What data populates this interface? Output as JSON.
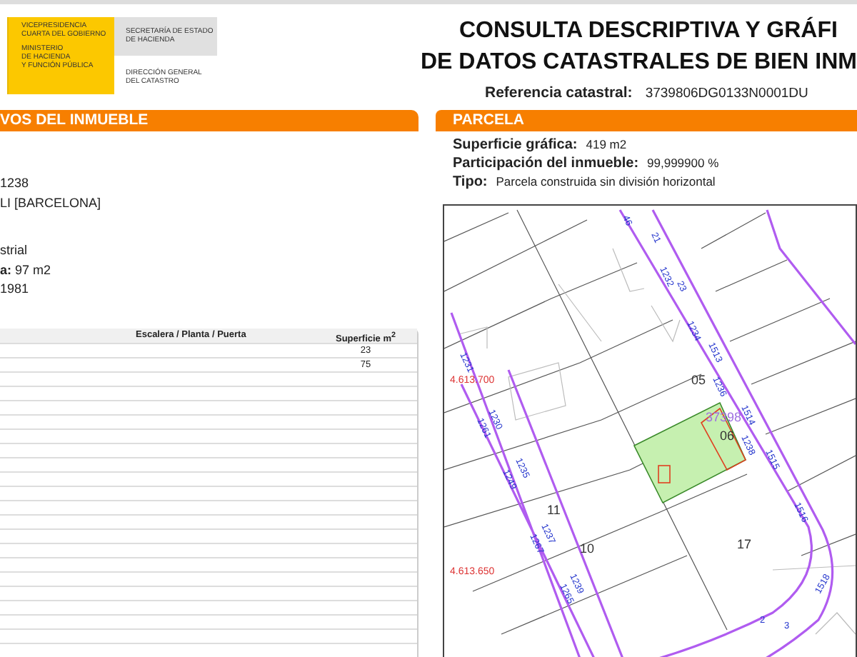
{
  "logo": {
    "yellow_texts": [
      [
        "VICEPRESIDENCIA",
        "CUARTA DEL GOBIERNO"
      ],
      [
        "MINISTERIO",
        "DE HACIENDA",
        "Y FUNCIÓN PÚBLICA"
      ]
    ],
    "gray_text": [
      "SECRETARÍA DE ESTADO",
      "DE HACIENDA"
    ],
    "white_text": [
      "DIRECCIÓN GENERAL",
      "DEL CATASTRO"
    ]
  },
  "title": [
    "CONSULTA DESCRIPTIVA Y GRÁFI",
    "DE DATOS CATASTRALES DE BIEN INM"
  ],
  "reference": {
    "label": "Referencia catastral:",
    "value": "3739806DG0133N0001DU"
  },
  "left_panel": {
    "header": "VOS DEL INMUEBLE",
    "line_groups": [
      [
        "1238",
        "LI [BARCELONA]"
      ],
      [
        "strial",
        "**a:** 97 m2",
        "1981"
      ]
    ],
    "table": {
      "columns": [
        "Escalera / Planta / Puerta",
        "Superficie m$^{2}$"
      ],
      "rows": [
        {
          "area": "23"
        },
        {
          "area": "75"
        }
      ]
    }
  },
  "parcel": {
    "header": "PARCELA",
    "fields": [
      {
        "label": "Superficie gráfica:",
        "value": "419 m2"
      },
      {
        "label": "Participación del inmueble:",
        "value": "99,999900 %"
      },
      {
        "label": "Tipo:",
        "value": "Parcela construida sin división horizontal"
      }
    ],
    "map_labels": [
      {
        "kind": "parcel",
        "text": "05"
      },
      {
        "kind": "parcel",
        "text": "06"
      },
      {
        "kind": "parcel",
        "text": "17"
      },
      {
        "kind": "parcel",
        "text": "11"
      },
      {
        "kind": "parcel",
        "text": "10"
      },
      {
        "kind": "coord",
        "text": "4.613.700"
      },
      {
        "kind": "coord",
        "text": "4.613.650"
      },
      {
        "kind": "ref",
        "text": "37398"
      },
      {
        "kind": "street",
        "text": "46"
      },
      {
        "kind": "street",
        "text": "21"
      },
      {
        "kind": "street",
        "text": "1232"
      },
      {
        "kind": "street",
        "text": "23"
      },
      {
        "kind": "street",
        "text": "1234"
      },
      {
        "kind": "street",
        "text": "1513"
      },
      {
        "kind": "street",
        "text": "1236"
      },
      {
        "kind": "street",
        "text": "1514"
      },
      {
        "kind": "street",
        "text": "1238"
      },
      {
        "kind": "street",
        "text": "1515"
      },
      {
        "kind": "street",
        "text": "1516"
      },
      {
        "kind": "street",
        "text": "1518"
      },
      {
        "kind": "street",
        "text": "1231"
      },
      {
        "kind": "street",
        "text": "1230"
      },
      {
        "kind": "street",
        "text": "1261"
      },
      {
        "kind": "street",
        "text": "1235"
      },
      {
        "kind": "street",
        "text": "1249"
      },
      {
        "kind": "street",
        "text": "1237"
      },
      {
        "kind": "street",
        "text": "1267"
      },
      {
        "kind": "street",
        "text": "1239"
      },
      {
        "kind": "street",
        "text": "1265"
      },
      {
        "kind": "street",
        "text": "2"
      },
      {
        "kind": "street",
        "text": "3"
      }
    ]
  }
}
